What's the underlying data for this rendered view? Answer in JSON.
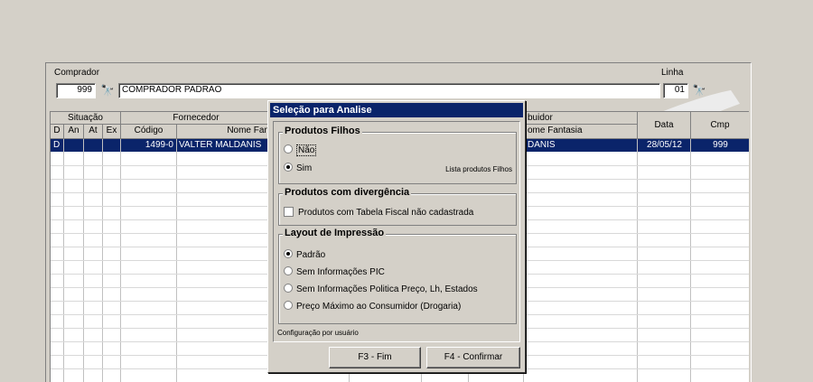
{
  "header": {
    "comprador_label": "Comprador",
    "comprador_code": "999",
    "comprador_name": "COMPRADOR PADRAO",
    "linha_label": "Linha",
    "linha_value": "01",
    "binoculars_glyph": "🔭"
  },
  "grid": {
    "group_headers": {
      "situacao": "Situação",
      "fornecedor": "Fornecedor",
      "distribuidor": "buidor"
    },
    "columns": {
      "d": "D",
      "an": "An",
      "at": "At",
      "ex": "Ex",
      "codigo": "Código",
      "nome_fantasia_forn": "Nome Fan",
      "nome_fantasia_dist": "ome Fantasia",
      "data": "Data",
      "cmp": "Cmp"
    },
    "rows": [
      {
        "d": "D",
        "an": "",
        "at": "",
        "ex": "",
        "codigo": "1499-0",
        "fornecedor": "VALTER MALDANIS",
        "distribuidor": "DANIS",
        "data": "28/05/12",
        "cmp": "999"
      }
    ]
  },
  "dialog": {
    "title": "Seleção para Analise",
    "produtos_filhos": {
      "title": "Produtos Filhos",
      "options": [
        "Não",
        "Sim"
      ],
      "selected": "Sim",
      "hint": "Lista produtos Filhos"
    },
    "divergencia": {
      "title": "Produtos com divergência",
      "checkbox_label": "Produtos com Tabela Fiscal não cadastrada",
      "checked": false
    },
    "layout": {
      "title": "Layout de Impressão",
      "options": [
        "Padrão",
        "Sem Informações PIC",
        "Sem Informações Politica Preço, Lh, Estados",
        "Preço Máximo ao Consumidor (Drogaria)"
      ],
      "selected": "Padrão"
    },
    "footer_note": "Configuração por usuário",
    "buttons": {
      "fim": "F3 - Fim",
      "confirmar": "F4 - Confirmar"
    }
  }
}
